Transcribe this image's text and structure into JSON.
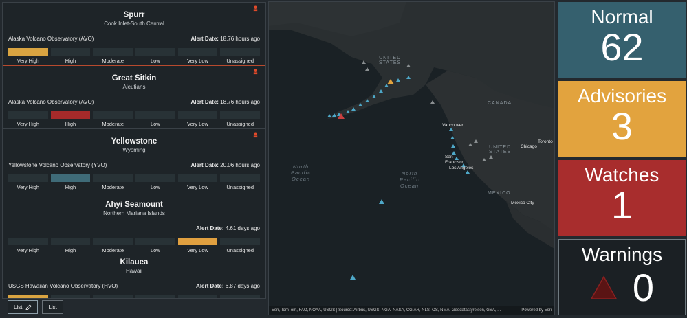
{
  "volcanoes": [
    {
      "name": "Spurr",
      "region": "Cook Inlet-South Central",
      "observatory": "Alaska Volcano Observatory (AVO)",
      "alert_label": "Alert Date:",
      "alert_value": "18.76 hours ago",
      "active_level": "Very High"
    },
    {
      "name": "Great Sitkin",
      "region": "Aleutians",
      "observatory": "Alaska Volcano Observatory (AVO)",
      "alert_label": "Alert Date:",
      "alert_value": "18.76 hours ago",
      "active_level": "High"
    },
    {
      "name": "Yellowstone",
      "region": "Wyoming",
      "observatory": "Yellowstone Volcano Observatory (YVO)",
      "alert_label": "Alert Date:",
      "alert_value": "20.06 hours ago",
      "active_level": "High"
    },
    {
      "name": "Ahyi Seamount",
      "region": "Northern Mariana Islands",
      "observatory": "",
      "alert_label": "Alert Date:",
      "alert_value": "4.61 days ago",
      "active_level": "Very Low"
    },
    {
      "name": "Kilauea",
      "region": "Hawaii",
      "observatory": "USGS Hawaiian Volcano Observatory (HVO)",
      "alert_label": "Alert Date:",
      "alert_value": "6.87 days ago",
      "active_level": "Very High"
    }
  ],
  "levels": [
    "Very High",
    "High",
    "Moderate",
    "Low",
    "Very Low",
    "Unassigned"
  ],
  "tabs": [
    {
      "label": "List"
    },
    {
      "label": "List"
    }
  ],
  "map": {
    "labels": {
      "us_north": "UNITED\nSTATES",
      "canada": "CANADA",
      "us": "UNITED\nSTATES",
      "mexico": "MEXICO",
      "ocean1": "North\nPacific\nOcean",
      "ocean2": "North\nPacific\nOcean"
    },
    "cities": [
      "Vancouver",
      "Chicago",
      "Toronto",
      "San Francisco",
      "Los Angeles",
      "Mexico City"
    ],
    "attribution": "Esri, TomTom, FAO, NOAA, USGS | Source: Airbus, USGS, NGA, NASA, CGIAR, NLS, OS, NMA, Geodatastyrelsen, GSA, ...",
    "powered": "Powered by Esri"
  },
  "stats": {
    "normal": {
      "title": "Normal",
      "value": "62",
      "color": "#35606e"
    },
    "advisories": {
      "title": "Advisories",
      "value": "3",
      "color": "#e2a33e"
    },
    "watches": {
      "title": "Watches",
      "value": "1",
      "color": "#a82d2d"
    },
    "warnings": {
      "title": "Warnings",
      "value": "0",
      "color": "#1b2024"
    }
  }
}
